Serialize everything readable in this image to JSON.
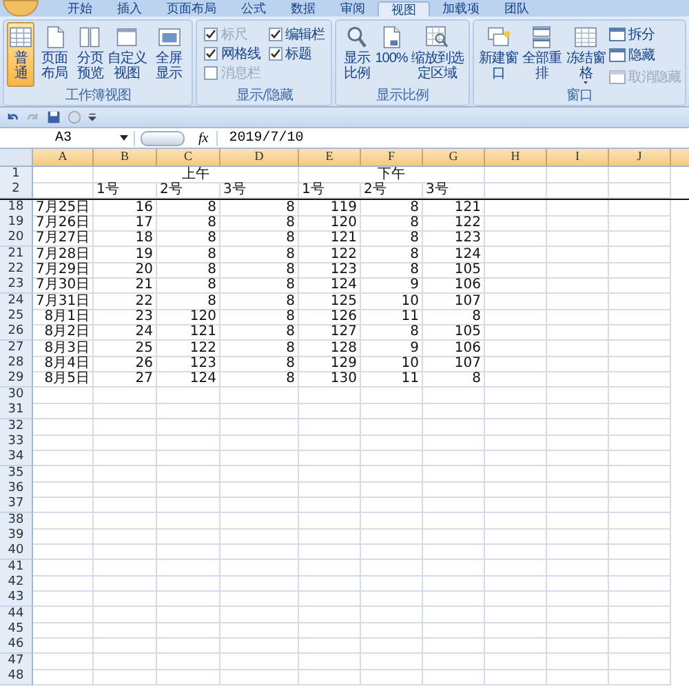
{
  "ribbon_tabs": [
    {
      "label": "开始",
      "selected": false
    },
    {
      "label": "插入",
      "selected": false
    },
    {
      "label": "页面布局",
      "selected": false
    },
    {
      "label": "公式",
      "selected": false
    },
    {
      "label": "数据",
      "selected": false
    },
    {
      "label": "审阅",
      "selected": false
    },
    {
      "label": "视图",
      "selected": true
    },
    {
      "label": "加载项",
      "selected": false
    },
    {
      "label": "团队",
      "selected": false
    }
  ],
  "ribbon_groups": [
    {
      "label": "工作簿视图",
      "items": [
        {
          "kind": "big",
          "label": "普通",
          "selected": true
        },
        {
          "kind": "big",
          "label": "页面布局",
          "selected": false
        },
        {
          "kind": "big",
          "label": "分页预览",
          "selected": false
        },
        {
          "kind": "big",
          "label": "自定义视图",
          "selected": false
        },
        {
          "kind": "big",
          "label": "全屏显示",
          "selected": false
        }
      ]
    },
    {
      "label": "显示/隐藏",
      "items": [
        {
          "kind": "check",
          "label": "标尺",
          "checked": true,
          "disabled": true
        },
        {
          "kind": "check",
          "label": "编辑栏",
          "checked": true,
          "disabled": false
        },
        {
          "kind": "check",
          "label": "网格线",
          "checked": true,
          "disabled": false
        },
        {
          "kind": "check",
          "label": "标题",
          "checked": true,
          "disabled": false
        },
        {
          "kind": "check",
          "label": "消息栏",
          "checked": false,
          "disabled": true
        }
      ]
    },
    {
      "label": "显示比例",
      "items": [
        {
          "kind": "big",
          "label": "显示比例",
          "selected": false
        },
        {
          "kind": "big",
          "label": "100%",
          "selected": false
        },
        {
          "kind": "big",
          "label": "缩放到选定区域",
          "selected": false
        }
      ]
    },
    {
      "label": "窗口",
      "items": [
        {
          "kind": "big",
          "label": "新建窗口",
          "selected": false
        },
        {
          "kind": "big",
          "label": "全部重排",
          "selected": false
        },
        {
          "kind": "menu",
          "label": "冻结窗格",
          "selected": false
        },
        {
          "kind": "small",
          "label": "拆分",
          "disabled": false
        },
        {
          "kind": "small",
          "label": "隐藏",
          "disabled": false
        },
        {
          "kind": "small",
          "label": "取消隐藏",
          "disabled": true
        }
      ]
    }
  ],
  "formula_bar": {
    "name_box": "A3",
    "function_label": "fx",
    "formula": "2019/7/10"
  },
  "sheet": {
    "columns": [
      "A",
      "B",
      "C",
      "D",
      "E",
      "F",
      "G",
      "H",
      "I",
      "J"
    ],
    "rows": [
      {
        "header": "1",
        "kind": "groups",
        "groups": [
          "上午",
          "下午"
        ]
      },
      {
        "header": "2",
        "kind": "subheads",
        "cells": [
          "1号",
          "2号",
          "3号",
          "1号",
          "2号",
          "3号"
        ]
      },
      {
        "header": "18",
        "kind": "data",
        "cells": [
          "7月25日",
          "16",
          "8",
          "8",
          "119",
          "8",
          "121"
        ]
      },
      {
        "header": "19",
        "kind": "data",
        "cells": [
          "7月26日",
          "17",
          "8",
          "8",
          "120",
          "8",
          "122"
        ]
      },
      {
        "header": "20",
        "kind": "data",
        "cells": [
          "7月27日",
          "18",
          "8",
          "8",
          "121",
          "8",
          "123"
        ]
      },
      {
        "header": "21",
        "kind": "data",
        "cells": [
          "7月28日",
          "19",
          "8",
          "8",
          "122",
          "8",
          "124"
        ]
      },
      {
        "header": "22",
        "kind": "data",
        "cells": [
          "7月29日",
          "20",
          "8",
          "8",
          "123",
          "8",
          "105"
        ]
      },
      {
        "header": "23",
        "kind": "data",
        "cells": [
          "7月30日",
          "21",
          "8",
          "8",
          "124",
          "9",
          "106"
        ]
      },
      {
        "header": "24",
        "kind": "data",
        "cells": [
          "7月31日",
          "22",
          "8",
          "8",
          "125",
          "10",
          "107"
        ]
      },
      {
        "header": "25",
        "kind": "data",
        "cells": [
          "8月1日",
          "23",
          "120",
          "8",
          "126",
          "11",
          "8"
        ]
      },
      {
        "header": "26",
        "kind": "data",
        "cells": [
          "8月2日",
          "24",
          "121",
          "8",
          "127",
          "8",
          "105"
        ]
      },
      {
        "header": "27",
        "kind": "data",
        "cells": [
          "8月3日",
          "25",
          "122",
          "8",
          "128",
          "9",
          "106"
        ]
      },
      {
        "header": "28",
        "kind": "data",
        "cells": [
          "8月4日",
          "26",
          "123",
          "8",
          "129",
          "10",
          "107"
        ]
      },
      {
        "header": "29",
        "kind": "data",
        "cells": [
          "8月5日",
          "27",
          "124",
          "8",
          "130",
          "11",
          "8"
        ]
      },
      {
        "header": "30",
        "kind": "empty"
      },
      {
        "header": "31",
        "kind": "empty"
      },
      {
        "header": "32",
        "kind": "empty"
      },
      {
        "header": "33",
        "kind": "empty"
      },
      {
        "header": "34",
        "kind": "empty"
      },
      {
        "header": "35",
        "kind": "empty"
      },
      {
        "header": "36",
        "kind": "empty"
      },
      {
        "header": "37",
        "kind": "empty"
      },
      {
        "header": "38",
        "kind": "empty"
      },
      {
        "header": "39",
        "kind": "empty"
      },
      {
        "header": "40",
        "kind": "empty"
      },
      {
        "header": "41",
        "kind": "empty"
      },
      {
        "header": "42",
        "kind": "empty"
      },
      {
        "header": "43",
        "kind": "empty"
      },
      {
        "header": "44",
        "kind": "empty"
      },
      {
        "header": "45",
        "kind": "empty"
      },
      {
        "header": "46",
        "kind": "empty"
      },
      {
        "header": "47",
        "kind": "empty"
      },
      {
        "header": "48",
        "kind": "empty"
      }
    ]
  }
}
